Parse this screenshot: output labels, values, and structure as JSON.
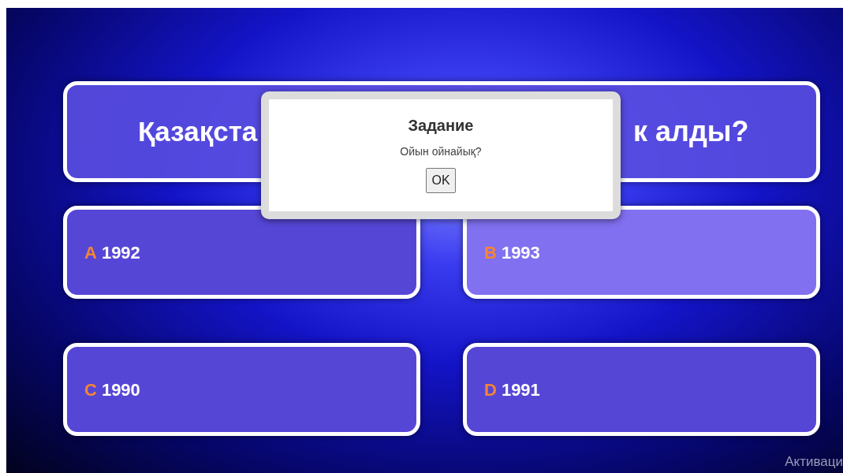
{
  "question": {
    "visible_start": "Қазақста",
    "visible_end": "к алды?"
  },
  "answers": [
    {
      "letter": "A",
      "text": "1992",
      "selected": false
    },
    {
      "letter": "B",
      "text": "1993",
      "selected": true
    },
    {
      "letter": "C",
      "text": "1990",
      "selected": false
    },
    {
      "letter": "D",
      "text": "1991",
      "selected": false
    }
  ],
  "dialog": {
    "title": "Задание",
    "message": "Ойын ойнайық?",
    "button": "OK"
  },
  "os_notice": "Активаци"
}
